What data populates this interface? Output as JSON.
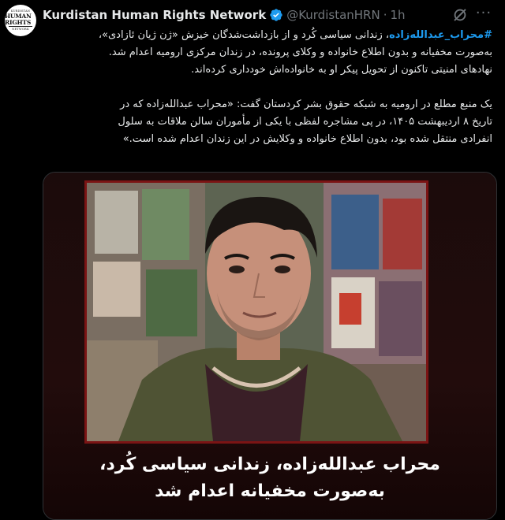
{
  "tweet": {
    "avatar_text": {
      "top": "KURDISTAN",
      "middle": "HUMAN RIGHTS",
      "bottom": "NETWORK"
    },
    "author": "Kurdistan Human Rights Network",
    "handle": "@KurdistanHRN",
    "separator": "·",
    "time": "1h",
    "verified_color": "#1d9bf0",
    "body": {
      "hashtag": "#محراب_عبدالله‌زاده",
      "line1_rest": "، زندانی سیاسی کُرد و از بازداشت‌شدگان خیزش «ژن ژیان ئازادی»،",
      "line2": "به‌صورت مخفیانه و بدون اطلاع خانواده و وکلای پرونده، در زندان مرکزی ارومیه اعدام شد.",
      "line3": "نهادهای امنیتی تاکنون از تحویل پیکر او به خانواده‌اش خودداری کرده‌اند.",
      "line4": "یک منبع مطلع در ارومیه به شبکه حقوق بشر کردستان گفت: «محراب عبدالله‌زاده که در",
      "line5": "تاریخ ۸ اردیبهشت ۱۴۰۵، در پی مشاجره لفظی با یکی از مأموران سالن ملاقات به سلول",
      "line6": "انفرادی منتقل شده بود، بدون اطلاع خانواده و وکلایش در این زندان اعدام شده است.»"
    },
    "media": {
      "caption_line1": "محراب عبدالله‌زاده، زندانی سیاسی کُرد،",
      "caption_line2": "به‌صورت مخفیانه اعدام شد"
    }
  },
  "icons": {
    "verified": "verified-badge-icon",
    "grok": "grok-icon",
    "more": "more-options-icon"
  }
}
